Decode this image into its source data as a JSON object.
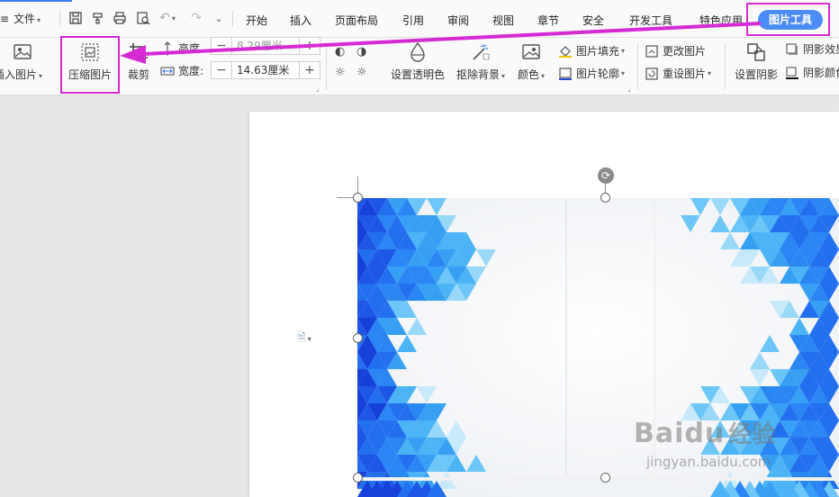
{
  "menu": {
    "file_label": "文件"
  },
  "tabs": [
    "开始",
    "插入",
    "页面布局",
    "引用",
    "审阅",
    "视图",
    "章节",
    "安全",
    "开发工具",
    "特色应用"
  ],
  "active_tab": "图片工具",
  "ribbon": {
    "insert_picture": "插入图片",
    "compress_picture": "压缩图片",
    "crop": "裁剪",
    "height_label": "高度",
    "height_value": "8.29厘米",
    "width_label": "宽度:",
    "width_value": "14.63厘米",
    "set_transparent": "设置透明色",
    "remove_background": "抠除背景",
    "color": "颜色",
    "picture_fill": "图片填充",
    "picture_outline": "图片轮廓",
    "change_picture": "更改图片",
    "reset_picture": "重设图片",
    "set_shadow": "设置阴影",
    "shadow_effect": "阴影效果",
    "shadow_color": "阴影颜色"
  },
  "watermark": {
    "brand": "Baidu",
    "brand_cn": "经验",
    "url": "jingyan.baidu.com"
  },
  "colors": {
    "accent": "#4c8cf6",
    "highlight": "#d62ad4",
    "tri_dark": "#1e56e6",
    "tri_light": "#3fb2f5"
  }
}
